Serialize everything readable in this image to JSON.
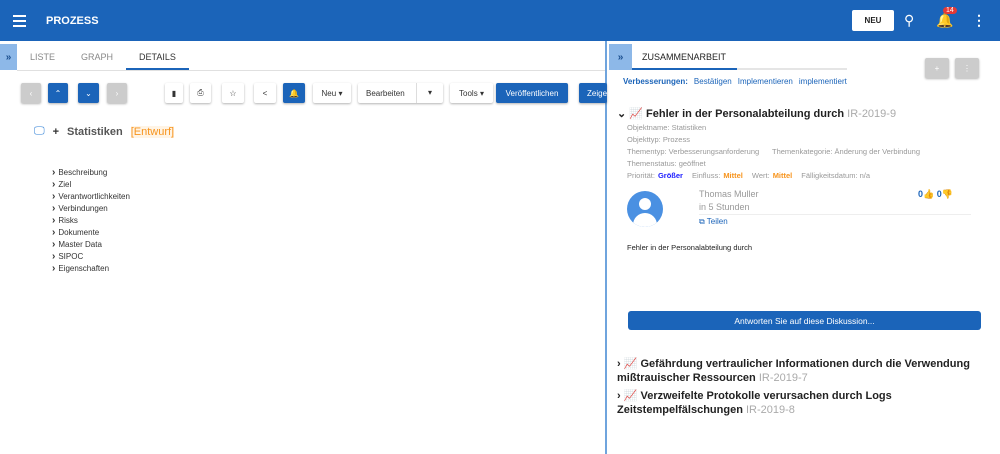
{
  "header": {
    "title": "PROZESS",
    "new_label": "NEU",
    "notification_count": "14"
  },
  "left": {
    "tabs": [
      "LISTE",
      "GRAPH",
      "DETAILS"
    ],
    "toolbar": {
      "new": "Neu",
      "edit": "Bearbeiten",
      "tools": "Tools",
      "publish": "Veröffentlichen",
      "show": "Zeige"
    },
    "object": {
      "name": "Statistiken",
      "status": "[Entwurf]"
    },
    "sections": [
      "Beschreibung",
      "Ziel",
      "Verantwortlichkeiten",
      "Verbindungen",
      "Risks",
      "Dokumente",
      "Master Data",
      "SIPOC",
      "Eigenschaften"
    ]
  },
  "right": {
    "tab": "ZUSAMMENARBEIT",
    "filters": {
      "label": "Verbesserungen:",
      "items": [
        "Bestätigen",
        "Implementieren",
        "implementiert"
      ]
    },
    "issue": {
      "title": "Fehler in der Personalabteilung durch",
      "id": "IR-2019-9",
      "object_name": "Objektname: Statistiken",
      "object_type": "Objekttyp: Prozess",
      "topic_type": "Thementyp: Verbesserungsanforderung",
      "topic_category": "Themenkategorie: Änderung der Verbindung",
      "topic_status": "Themenstatus: geöffnet",
      "priority_label": "Priorität:",
      "priority": "Größer",
      "impact_label": "Einfluss:",
      "impact": "Mittel",
      "value_label": "Wert:",
      "value": "Mittel",
      "due": "Fälligkeitsdatum: n/a",
      "author": "Thomas Muller",
      "time": "in 5 Stunden",
      "share": "Teilen",
      "likes": "0",
      "dislikes": "0",
      "body": "Fehler in der Personalabteilung durch",
      "reply": "Antworten Sie auf diese Diskussion..."
    },
    "other_issues": [
      {
        "title": "Gefährdung vertraulicher Informationen durch die Verwendung mißtrauischer Ressourcen",
        "id": "IR-2019-7"
      },
      {
        "title": "Verzweifelte Protokolle verursachen durch Logs Zeitstempelfälschungen",
        "id": "IR-2019-8"
      }
    ]
  },
  "colors": {
    "primary": "#1b64b9",
    "orange": "#f7941d",
    "priority": "#1a1aff"
  }
}
